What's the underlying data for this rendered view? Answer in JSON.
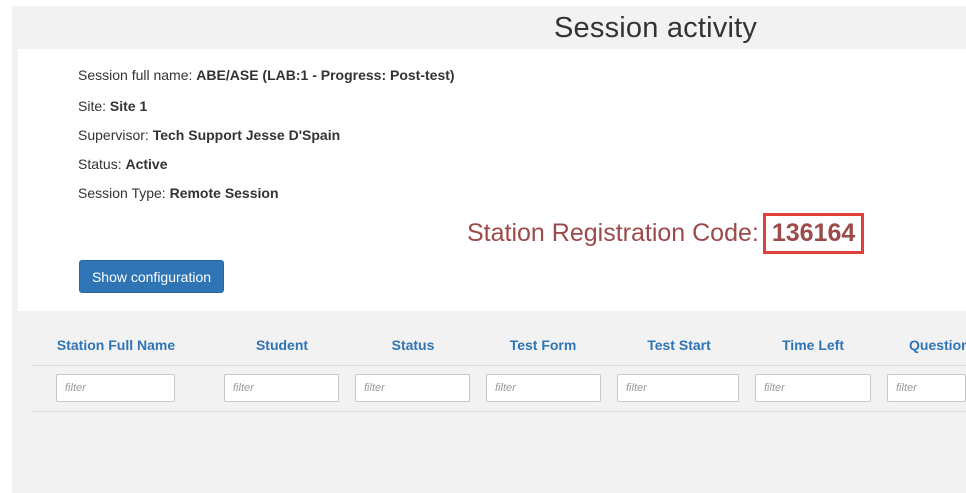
{
  "page_title": "Session activity",
  "session": {
    "full_name_label": "Session full name:",
    "full_name_value": "ABE/ASE (LAB:1 - Progress: Post-test)",
    "site_label": "Site:",
    "site_value": "Site 1",
    "supervisor_label": "Supervisor:",
    "supervisor_value": "Tech Support Jesse D'Spain",
    "status_label": "Status:",
    "status_value": "Active",
    "type_label": "Session Type:",
    "type_value": "Remote Session"
  },
  "registration": {
    "label": "Station Registration Code:",
    "code": "136164"
  },
  "buttons": {
    "show_configuration": "Show configuration"
  },
  "table": {
    "columns": [
      "Station Full Name",
      "Student",
      "Status",
      "Test Form",
      "Test Start",
      "Time Left",
      "Question"
    ],
    "filter_placeholder": "filter"
  },
  "colors": {
    "accent": "#2f74b5",
    "registration_text": "#9c4a4a",
    "highlight_border": "#e0403a"
  }
}
